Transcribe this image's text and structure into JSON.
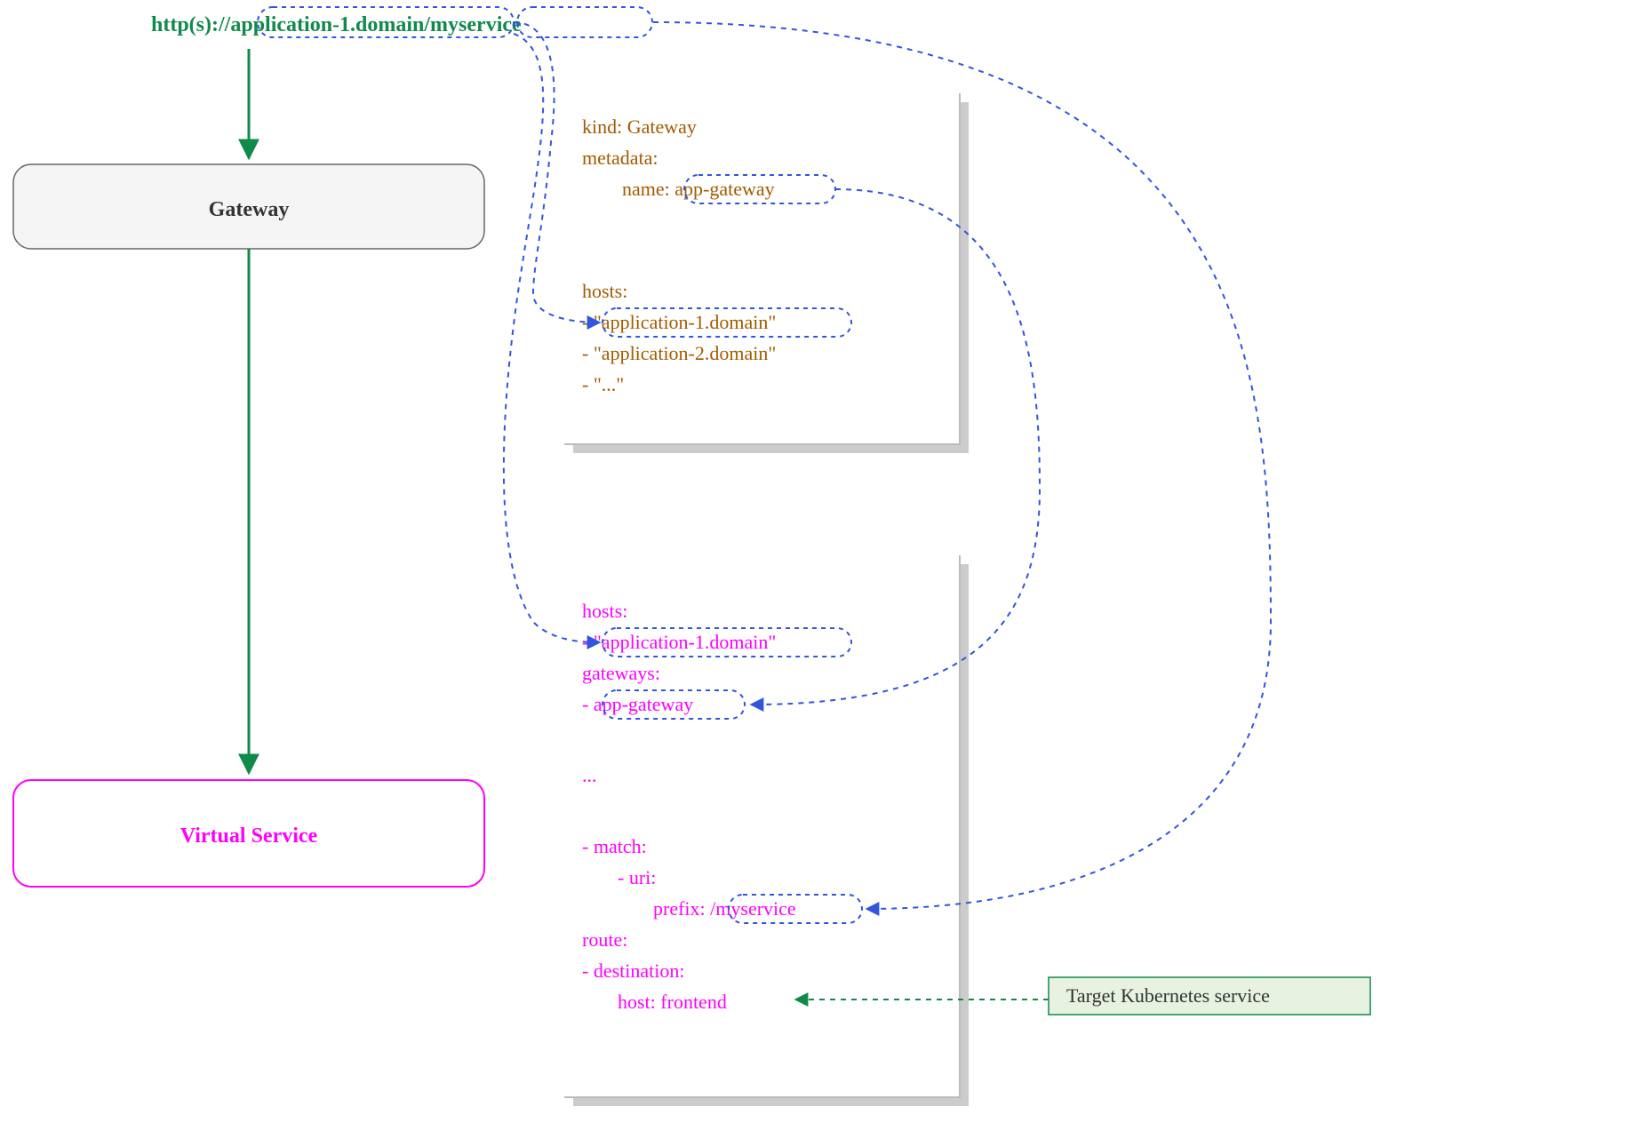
{
  "url": {
    "scheme": "http(s)://",
    "host": "application-1.domain",
    "path": "/myservice"
  },
  "left": {
    "gateway_label": "Gateway",
    "virtual_service_label": "Virtual Service"
  },
  "gateway_yaml": {
    "kind_line": "kind: Gateway",
    "metadata_line": "metadata:",
    "name_prefix": "name: ",
    "name_value": "app-gateway",
    "hosts_label": "hosts:",
    "host1_prefix": "- ",
    "host1_value": "\"application-1.domain\"",
    "host2": "- \"application-2.domain\"",
    "host3": "- \"...\""
  },
  "vs_yaml": {
    "hosts_label": "hosts:",
    "host1_prefix": "- ",
    "host1_value": "\"application-1.domain\"",
    "gateways_label": "gateways:",
    "gw_prefix": "- ",
    "gw_value": "app-gateway",
    "dots": "...",
    "match_label": "- match:",
    "uri_label": "- uri:",
    "prefix_prefix": "prefix: ",
    "prefix_value": "/myservice",
    "route_label": "route:",
    "dest_label": "- destination:",
    "host_line": "host: frontend"
  },
  "legend": {
    "target": "Target Kubernetes service"
  }
}
